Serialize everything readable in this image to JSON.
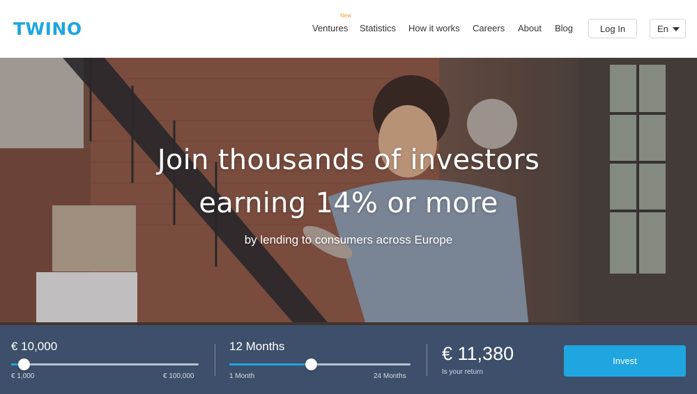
{
  "header": {
    "logo": "TWINO",
    "nav": [
      {
        "label": "Ventures",
        "badge": "New"
      },
      {
        "label": "Statistics"
      },
      {
        "label": "How it works"
      },
      {
        "label": "Careers"
      },
      {
        "label": "About"
      },
      {
        "label": "Blog"
      }
    ],
    "login_label": "Log In",
    "language": "En"
  },
  "hero": {
    "title_line1": "Join thousands of investors",
    "title_line2": "earning 14% or more",
    "subtitle": "by lending to consumers across Europe"
  },
  "calculator": {
    "amount": {
      "value": "€ 10,000",
      "min_label": "€ 1,000",
      "max_label": "€ 100,000",
      "fraction": 0.07
    },
    "period": {
      "value": "12 Months",
      "min_label": "1 Month",
      "max_label": "24 Months",
      "fraction": 0.45
    },
    "return": {
      "value": "€ 11,380",
      "label": "Is your return"
    },
    "invest_label": "Invest"
  },
  "colors": {
    "brand": "#1fa6e0",
    "calc_bar": "#3c5578",
    "badge": "#f0a020"
  }
}
